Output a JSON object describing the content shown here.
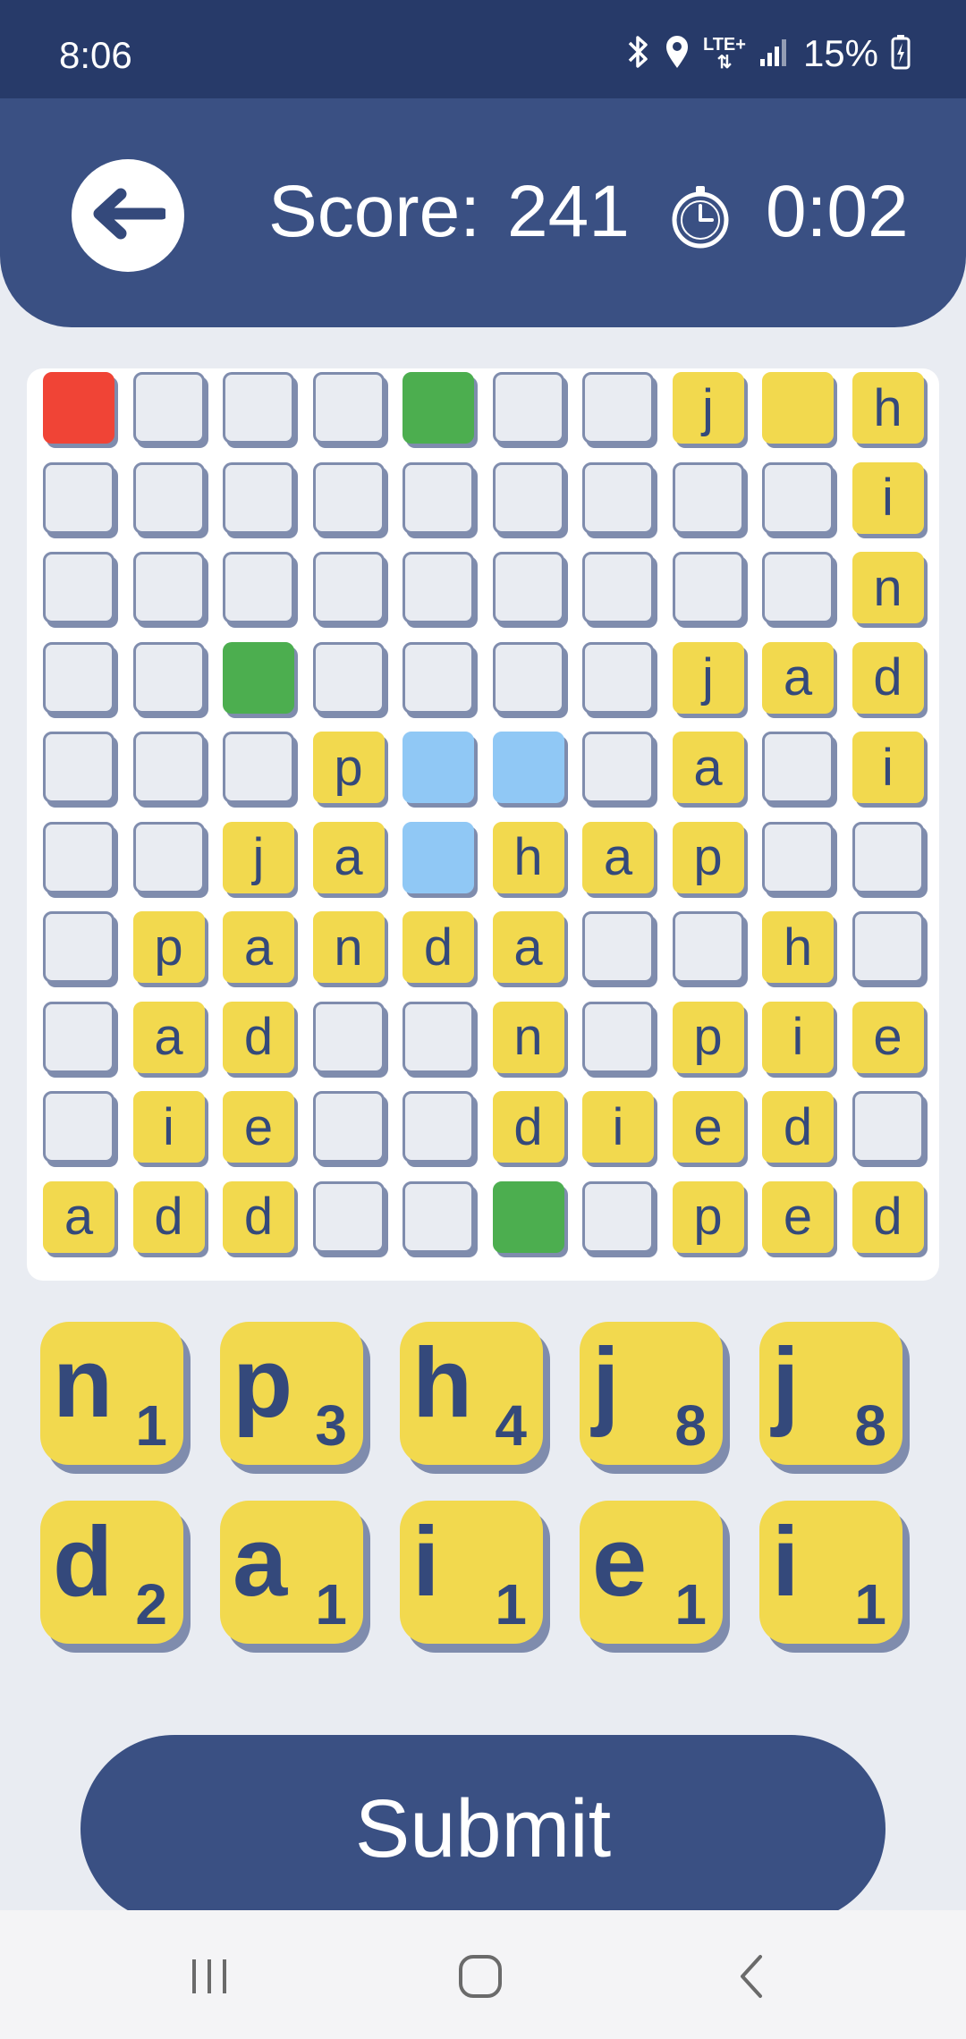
{
  "status_bar": {
    "time": "8:06",
    "network": "LTE+",
    "battery": "15%"
  },
  "header": {
    "score_label": "Score:",
    "score_value": "241",
    "timer": "0:02"
  },
  "board": {
    "rows": [
      [
        {
          "l": "",
          "c": "red"
        },
        {
          "l": "",
          "c": "empty"
        },
        {
          "l": "",
          "c": "empty"
        },
        {
          "l": "",
          "c": "empty"
        },
        {
          "l": "",
          "c": "green"
        },
        {
          "l": "",
          "c": "empty"
        },
        {
          "l": "",
          "c": "empty"
        },
        {
          "l": "j",
          "c": "yellow"
        },
        {
          "l": "",
          "c": "yellow"
        },
        {
          "l": "h",
          "c": "yellow"
        }
      ],
      [
        {
          "l": "",
          "c": "empty"
        },
        {
          "l": "",
          "c": "empty"
        },
        {
          "l": "",
          "c": "empty"
        },
        {
          "l": "",
          "c": "empty"
        },
        {
          "l": "",
          "c": "empty"
        },
        {
          "l": "",
          "c": "empty"
        },
        {
          "l": "",
          "c": "empty"
        },
        {
          "l": "",
          "c": "empty"
        },
        {
          "l": "",
          "c": "empty"
        },
        {
          "l": "i",
          "c": "yellow"
        }
      ],
      [
        {
          "l": "",
          "c": "empty"
        },
        {
          "l": "",
          "c": "empty"
        },
        {
          "l": "",
          "c": "empty"
        },
        {
          "l": "",
          "c": "empty"
        },
        {
          "l": "",
          "c": "empty"
        },
        {
          "l": "",
          "c": "empty"
        },
        {
          "l": "",
          "c": "empty"
        },
        {
          "l": "",
          "c": "empty"
        },
        {
          "l": "",
          "c": "empty"
        },
        {
          "l": "n",
          "c": "yellow"
        }
      ],
      [
        {
          "l": "",
          "c": "empty"
        },
        {
          "l": "",
          "c": "empty"
        },
        {
          "l": "",
          "c": "green"
        },
        {
          "l": "",
          "c": "empty"
        },
        {
          "l": "",
          "c": "empty"
        },
        {
          "l": "",
          "c": "empty"
        },
        {
          "l": "",
          "c": "empty"
        },
        {
          "l": "j",
          "c": "yellow"
        },
        {
          "l": "a",
          "c": "yellow"
        },
        {
          "l": "d",
          "c": "yellow"
        }
      ],
      [
        {
          "l": "",
          "c": "empty"
        },
        {
          "l": "",
          "c": "empty"
        },
        {
          "l": "",
          "c": "empty"
        },
        {
          "l": "p",
          "c": "yellow"
        },
        {
          "l": "",
          "c": "blue"
        },
        {
          "l": "",
          "c": "blue"
        },
        {
          "l": "",
          "c": "empty"
        },
        {
          "l": "a",
          "c": "yellow"
        },
        {
          "l": "",
          "c": "empty"
        },
        {
          "l": "i",
          "c": "yellow"
        }
      ],
      [
        {
          "l": "",
          "c": "empty"
        },
        {
          "l": "",
          "c": "empty"
        },
        {
          "l": "j",
          "c": "yellow"
        },
        {
          "l": "a",
          "c": "yellow"
        },
        {
          "l": "",
          "c": "blue"
        },
        {
          "l": "h",
          "c": "yellow"
        },
        {
          "l": "a",
          "c": "yellow"
        },
        {
          "l": "p",
          "c": "yellow"
        },
        {
          "l": "",
          "c": "empty"
        },
        {
          "l": "",
          "c": "empty"
        }
      ],
      [
        {
          "l": "",
          "c": "empty"
        },
        {
          "l": "p",
          "c": "yellow"
        },
        {
          "l": "a",
          "c": "yellow"
        },
        {
          "l": "n",
          "c": "yellow"
        },
        {
          "l": "d",
          "c": "yellow"
        },
        {
          "l": "a",
          "c": "yellow"
        },
        {
          "l": "",
          "c": "empty"
        },
        {
          "l": "",
          "c": "empty"
        },
        {
          "l": "h",
          "c": "yellow"
        },
        {
          "l": "",
          "c": "empty"
        }
      ],
      [
        {
          "l": "",
          "c": "empty"
        },
        {
          "l": "a",
          "c": "yellow"
        },
        {
          "l": "d",
          "c": "yellow"
        },
        {
          "l": "",
          "c": "empty"
        },
        {
          "l": "",
          "c": "empty"
        },
        {
          "l": "n",
          "c": "yellow"
        },
        {
          "l": "",
          "c": "empty"
        },
        {
          "l": "p",
          "c": "yellow"
        },
        {
          "l": "i",
          "c": "yellow"
        },
        {
          "l": "e",
          "c": "yellow"
        }
      ],
      [
        {
          "l": "",
          "c": "empty"
        },
        {
          "l": "i",
          "c": "yellow"
        },
        {
          "l": "e",
          "c": "yellow"
        },
        {
          "l": "",
          "c": "empty"
        },
        {
          "l": "",
          "c": "empty"
        },
        {
          "l": "d",
          "c": "yellow"
        },
        {
          "l": "i",
          "c": "yellow"
        },
        {
          "l": "e",
          "c": "yellow"
        },
        {
          "l": "d",
          "c": "yellow"
        },
        {
          "l": "",
          "c": "empty"
        }
      ],
      [
        {
          "l": "a",
          "c": "yellow"
        },
        {
          "l": "d",
          "c": "yellow"
        },
        {
          "l": "d",
          "c": "yellow"
        },
        {
          "l": "",
          "c": "empty"
        },
        {
          "l": "",
          "c": "empty"
        },
        {
          "l": "",
          "c": "green"
        },
        {
          "l": "",
          "c": "empty"
        },
        {
          "l": "p",
          "c": "yellow"
        },
        {
          "l": "e",
          "c": "yellow"
        },
        {
          "l": "d",
          "c": "yellow"
        }
      ]
    ]
  },
  "rack": [
    {
      "letter": "n",
      "points": "1"
    },
    {
      "letter": "p",
      "points": "3"
    },
    {
      "letter": "h",
      "points": "4"
    },
    {
      "letter": "j",
      "points": "8"
    },
    {
      "letter": "j",
      "points": "8"
    },
    {
      "letter": "d",
      "points": "2"
    },
    {
      "letter": "a",
      "points": "1"
    },
    {
      "letter": "i",
      "points": "1"
    },
    {
      "letter": "e",
      "points": "1"
    },
    {
      "letter": "i",
      "points": "1"
    }
  ],
  "submit_label": "Submit",
  "icons": {
    "back": "arrow-left-icon",
    "timer": "stopwatch-icon",
    "bluetooth": "bluetooth-icon",
    "location": "location-icon",
    "signal": "signal-icon",
    "battery": "battery-charging-icon",
    "nav_recents": "recents-icon",
    "nav_home": "home-icon",
    "nav_back": "back-chevron-icon"
  },
  "colors": {
    "primary": "#3a5083",
    "status_bar": "#273a69",
    "tile_yellow": "#f2d94e",
    "tile_red": "#f04436",
    "tile_green": "#4cae4f",
    "tile_blue": "#90c8f5",
    "text_dark": "#34497b"
  }
}
